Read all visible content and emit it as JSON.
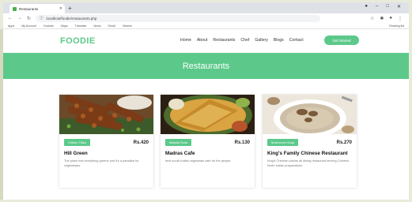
{
  "browser": {
    "tab_title": "Restaurants",
    "url": "localhost/foodie/restaurants.php",
    "bookmarks": [
      "Apps",
      "My Account",
      "Youtube",
      "Maps",
      "Translate",
      "News",
      "Gmail",
      "Vitamin"
    ],
    "reading_list": "Reading list"
  },
  "site": {
    "logo": "FOODIE",
    "menu": [
      "Home",
      "About",
      "Restaurants",
      "Chef",
      "Gallery",
      "Blogs",
      "Contact"
    ],
    "cta": "Get Started"
  },
  "hero": {
    "title": "Restaurants"
  },
  "restaurants": [
    {
      "badge": "Chiken Tikka",
      "price": "Rs.420",
      "name": "Hill Green",
      "description": "The place has everything greens and it's a paradise for vegetarians."
    },
    {
      "badge": "Masala Dosa",
      "price": "Rs.130",
      "name": "Madras Cafe",
      "description": "best south-Indian vegetarian cafe for the people."
    },
    {
      "badge": "Mushroom Soup",
      "price": "Rs.270",
      "name": "King's Family Chinese Restaurant",
      "description": "King's Chinese cuisine all dining restaurant serving Chinese, North Indian preparations."
    }
  ],
  "colors": {
    "accent": "#5cc98a"
  }
}
